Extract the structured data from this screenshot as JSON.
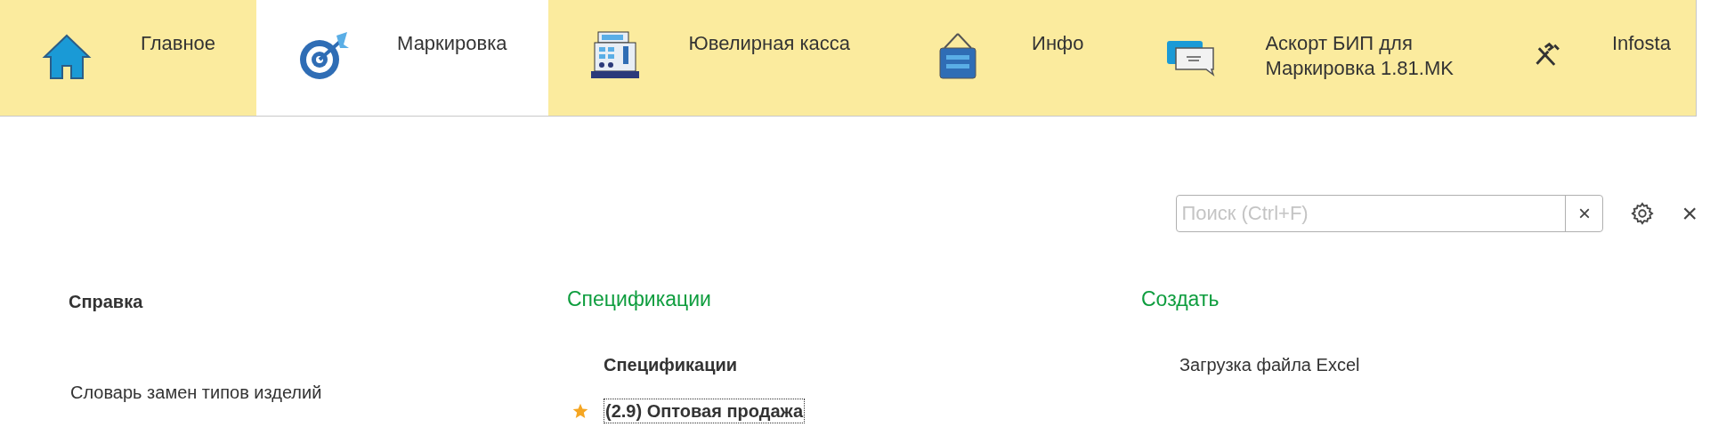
{
  "tabs": [
    {
      "label": "Главное",
      "selected": false
    },
    {
      "label": "Маркировка",
      "selected": true
    },
    {
      "label": "Ювелирная касса",
      "selected": false
    },
    {
      "label": "Инфо",
      "selected": false
    },
    {
      "label": "Аскорт БИП для\nМаркировка 1.81.MK",
      "selected": false
    },
    {
      "label": "Infosta",
      "selected": false
    }
  ],
  "search": {
    "placeholder": "Поиск (Ctrl+F)",
    "clear": "×"
  },
  "close": "×",
  "columns": [
    {
      "heading": {
        "kind": "plain",
        "text": "Справка"
      },
      "entries": [
        {
          "kind": "link",
          "text": "Словарь замен типов изделий",
          "important": false,
          "selected": false
        }
      ]
    },
    {
      "heading": {
        "kind": "section",
        "text": "Спецификации"
      },
      "entries": [
        {
          "kind": "group",
          "text": "Спецификации"
        },
        {
          "kind": "link",
          "text": "(2.9) Оптовая продажа",
          "favorite": true,
          "important": true,
          "selected": true
        }
      ]
    },
    {
      "heading": {
        "kind": "section",
        "text": "Создать"
      },
      "entries": [
        {
          "kind": "link",
          "text": "Загрузка файла Excel",
          "favorite": false,
          "important": false,
          "selected": false
        }
      ]
    }
  ]
}
